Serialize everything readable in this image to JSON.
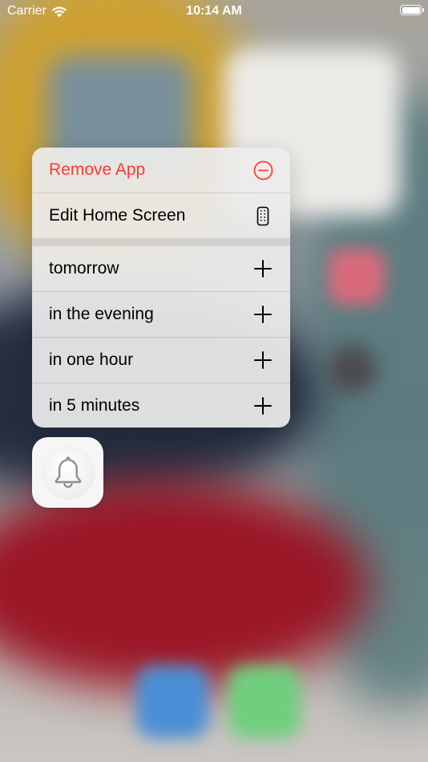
{
  "status_bar": {
    "carrier": "Carrier",
    "time": "10:14 AM",
    "wifi_icon": "wifi-icon",
    "battery_icon": "battery-icon"
  },
  "context_menu": {
    "items": [
      {
        "label": "Remove App",
        "icon": "minus-circle-icon",
        "destructive": true
      },
      {
        "label": "Edit Home Screen",
        "icon": "iphone-icon"
      },
      {
        "label": "tomorrow",
        "icon": "plus-icon"
      },
      {
        "label": "in the evening",
        "icon": "plus-icon"
      },
      {
        "label": "in one hour",
        "icon": "plus-icon"
      },
      {
        "label": "in 5 minutes",
        "icon": "plus-icon"
      }
    ]
  },
  "app_icon": {
    "icon": "bell-icon"
  },
  "colors": {
    "destructive": "#ff3b30",
    "menu_background": "#ececec",
    "icon_gray": "#8e8e93"
  }
}
